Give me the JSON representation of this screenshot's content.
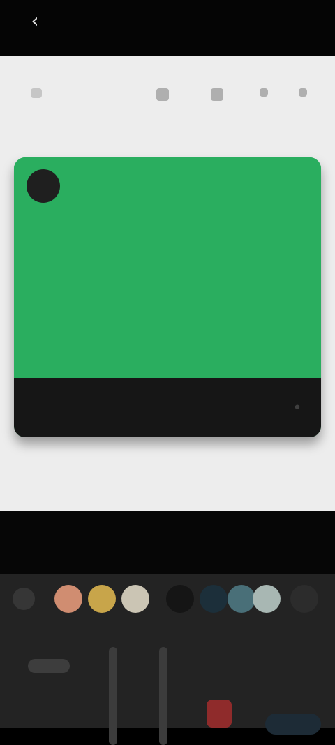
{
  "header": {
    "back_icon": "chevron-left-icon",
    "back_label": ""
  },
  "toolbar": {
    "items": [
      {
        "name": "menu-icon"
      },
      {
        "name": "tool-icon-1"
      },
      {
        "name": "tool-icon-2"
      },
      {
        "name": "tool-icon-3"
      },
      {
        "name": "tool-icon-4"
      }
    ]
  },
  "card": {
    "title": "",
    "subtitle": "",
    "accent": "#2aae5f",
    "footer_icon": "dot-icon"
  },
  "palette": {
    "colors": [
      "#363636",
      "#d08d71",
      "#c8a54a",
      "#cbc5b4",
      "#151515",
      "#1c2f3a",
      "#496f78",
      "#a8b7b3",
      "#2c2c2c"
    ]
  },
  "bottom": {
    "buttons": [
      {
        "label": ""
      },
      {
        "label": ""
      },
      {
        "label": ""
      }
    ],
    "accent": "#8f2b2b"
  }
}
